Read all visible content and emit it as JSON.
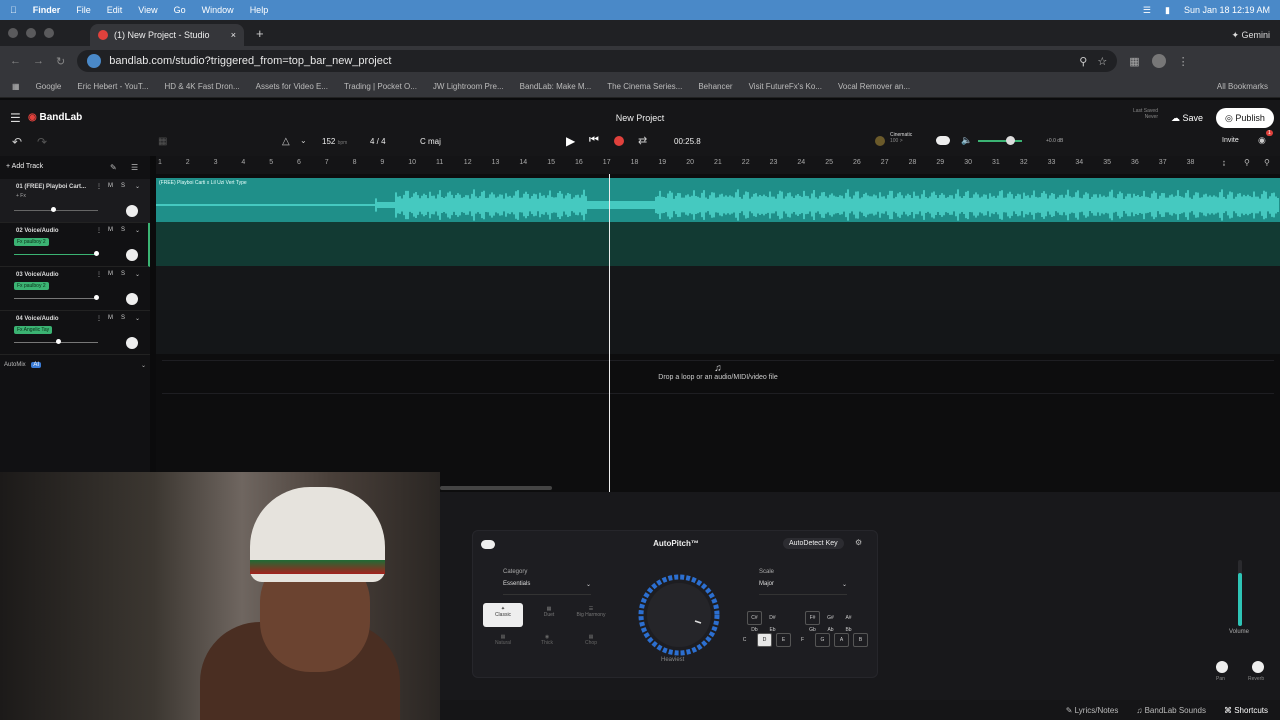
{
  "menubar": {
    "apple": "",
    "app": "Finder",
    "items": [
      "File",
      "Edit",
      "View",
      "Go",
      "Window",
      "Help"
    ],
    "time": "Sun Jan 18  12:19 AM"
  },
  "browser": {
    "tab_title": "(1) New Project - Studio",
    "url": "bandlab.com/studio?triggered_from=top_bar_new_project",
    "gemini": "Gemini",
    "bookmarks": [
      "Google",
      "Eric Hebert - YouT...",
      "HD & 4K Fast Dron...",
      "Assets for Video E...",
      "Trading | Pocket O...",
      "JW Lightroom Pre...",
      "BandLab: Make M...",
      "The Cinema Series...",
      "Behancer",
      "Visit FutureFx's Ko...",
      "Vocal Remover an..."
    ],
    "all_bookmarks": "All Bookmarks"
  },
  "app": {
    "brand": "BandLab",
    "project_title": "New Project",
    "last_saved_label": "Last Saved",
    "last_saved_value": "Never",
    "save": "Save",
    "publish": "Publish",
    "invite": "Invite",
    "bpm": "152",
    "bpm_unit": "bpm",
    "time_sig": "4 / 4",
    "key": "C maj",
    "time": "00:25.8",
    "preset_name": "Cinematic",
    "preset_sub": "100 >",
    "master_db": "+0.0 dB",
    "notif_count": "1",
    "add_track": "Add Track",
    "automix": "AutoMix",
    "ai_badge": "AI",
    "drop_text": "Drop a loop or an audio/MIDI/video file",
    "ruler": [
      "1",
      "2",
      "3",
      "4",
      "5",
      "6",
      "7",
      "8",
      "9",
      "10",
      "11",
      "12",
      "13",
      "14",
      "15",
      "16",
      "17",
      "18",
      "19",
      "20",
      "21",
      "22",
      "23",
      "24",
      "25",
      "26",
      "27",
      "28",
      "29",
      "30",
      "31",
      "32",
      "33",
      "34",
      "35",
      "36",
      "37",
      "38"
    ]
  },
  "tracks": [
    {
      "num": "01",
      "name": "(FREE) Playboi Cart...",
      "fx": "+ Fx",
      "fx_badge": false,
      "clip": "(FREE) Playboi Carti x Lil Uzi Vert Type",
      "fader": 0.45
    },
    {
      "num": "02",
      "name": "Voice/Audio",
      "fx": "Fx paulboy 2",
      "fx_badge": true,
      "fader": 0.97
    },
    {
      "num": "03",
      "name": "Voice/Audio",
      "fx": "Fx paulboy 2",
      "fx_badge": true,
      "fader": 0.97
    },
    {
      "num": "04",
      "name": "Voice/Audio",
      "fx": "Fx Angelic Tay",
      "fx_badge": true,
      "fader": 0.52
    }
  ],
  "track_btns": {
    "m": "M",
    "s": "S"
  },
  "autopitch": {
    "title": "AutoPitch™",
    "detect": "AutoDetect Key",
    "category_label": "Category",
    "category_value": "Essentials",
    "scale_label": "Scale",
    "scale_value": "Major",
    "styles": [
      "Classic",
      "Duet",
      "Big Harmony",
      "Natural",
      "Thick",
      "Chop"
    ],
    "knob_label": "Heaviest",
    "sharps": [
      "C#\nDb",
      "D#\nEb",
      "F#\nGb",
      "G#\nAb",
      "A#\nBb"
    ],
    "naturals": [
      "C",
      "D",
      "E",
      "F",
      "G",
      "A",
      "B"
    ]
  },
  "mixer": {
    "volume": "Volume",
    "pan": "Pan",
    "reverb": "Reverb",
    "volume_level": 0.8
  },
  "status": {
    "lyrics": "Lyrics/Notes",
    "sounds": "BandLab Sounds",
    "shortcuts": "Shortcuts"
  },
  "colors": {
    "accent": "#2ec4b6",
    "record": "#e0413c",
    "green": "#3bb373"
  }
}
